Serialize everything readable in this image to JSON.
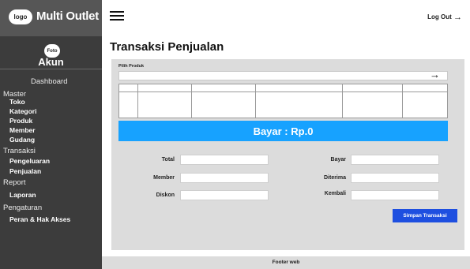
{
  "brand": {
    "logo_text": "logo",
    "name": "Multi Outlet"
  },
  "account": {
    "photo_text": "Foto",
    "label": "Akun"
  },
  "sidebar": {
    "items": [
      {
        "label": "Dashboard",
        "kind": "link"
      },
      {
        "label": "Master",
        "kind": "section"
      },
      {
        "label": "Toko",
        "kind": "link"
      },
      {
        "label": "Kategori",
        "kind": "link"
      },
      {
        "label": "Produk",
        "kind": "link"
      },
      {
        "label": "Member",
        "kind": "link"
      },
      {
        "label": "Gudang",
        "kind": "link"
      },
      {
        "label": "Transaksi",
        "kind": "section"
      },
      {
        "label": "Pengeluaran",
        "kind": "link"
      },
      {
        "label": "Penjualan",
        "kind": "link"
      },
      {
        "label": "Report",
        "kind": "section"
      },
      {
        "label": "Laporan",
        "kind": "link"
      },
      {
        "label": "Pengaturan",
        "kind": "section"
      },
      {
        "label": "Peran & Hak Akses",
        "kind": "link"
      }
    ]
  },
  "topbar": {
    "menu_icon": "hamburger-icon",
    "logout_label": "Log Out",
    "logout_icon": "arrow-right-icon"
  },
  "page": {
    "title": "Transaksi Penjualan"
  },
  "product_picker": {
    "label": "Pilih Produk",
    "value": "",
    "arrow_icon": "arrow-right-icon"
  },
  "bayar_banner": "Bayar : Rp.0",
  "form": {
    "left": [
      {
        "label": "Total",
        "value": ""
      },
      {
        "label": "Member",
        "value": ""
      },
      {
        "label": "Diskon",
        "value": ""
      }
    ],
    "right": [
      {
        "label": "Bayar",
        "value": ""
      },
      {
        "label": "Diterima",
        "value": ""
      },
      {
        "label": "Kembali",
        "value": ""
      }
    ]
  },
  "save_button": "Simpan Transaksi",
  "footer": "Footer web",
  "colors": {
    "sidebar_bg": "#3c3c3c",
    "brand_bg": "#565656",
    "accent_blue": "#17a2ff",
    "button_blue": "#1e4fe0",
    "panel_bg": "#dcdcdc"
  }
}
